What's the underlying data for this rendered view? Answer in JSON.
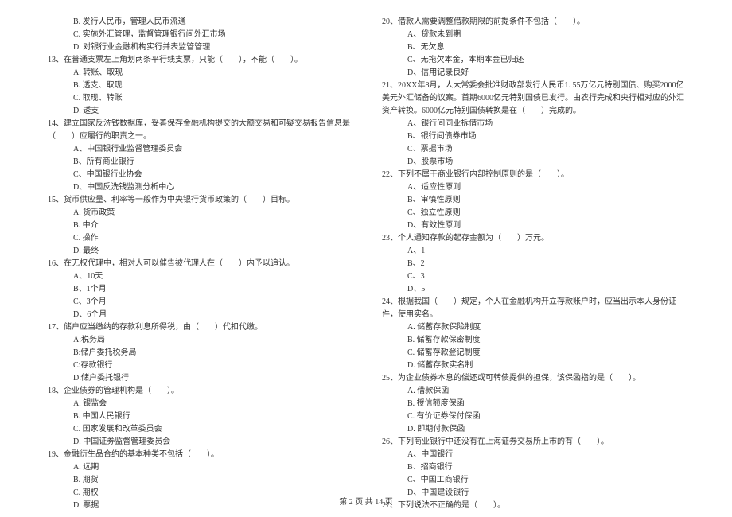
{
  "col_left": {
    "q12_opts": {
      "B": "B. 发行人民币，管理人民币流通",
      "C": "C. 实施外汇管理，监督管理银行间外汇市场",
      "D": "D. 对银行业金融机构实行并表监管管理"
    },
    "q13": {
      "stem": "13、在普通支票左上角划两条平行线支票，只能（　　），不能（　　）。",
      "A": "A. 转账、取现",
      "B": "B. 透支、取现",
      "C": "C. 取现、转账",
      "D": "D. 透支"
    },
    "q14": {
      "stem": "14、建立国家反洗钱数据库，妥善保存金融机构提交的大额交易和可疑交易报告信息是（　　）应履行的职责之一。",
      "A": "A、中国银行业监督管理委员会",
      "B": "B、所有商业银行",
      "C": "C、中国银行业协会",
      "D": "D、中国反洗钱监测分析中心"
    },
    "q15": {
      "stem": "15、货币供应量、利率等一般作为中央银行货币政策的（　　）目标。",
      "A": "A. 货币政策",
      "B": "B. 中介",
      "C": "C. 操作",
      "D": "D. 最终"
    },
    "q16": {
      "stem": "16、在无权代理中，相对人可以催告被代理人在（　　）内予以追认。",
      "A": "A、10天",
      "B": "B、1个月",
      "C": "C、3个月",
      "D": "D、6个月"
    },
    "q17": {
      "stem": "17、储户应当缴纳的存款利息所得税，由（　　）代扣代缴。",
      "A": "A:税务局",
      "B": "B:储户委托税务局",
      "C": "C:存款银行",
      "D": "D:储户委托银行"
    },
    "q18": {
      "stem": "18、企业债券的管理机构是（　　）。",
      "A": "A. 银监会",
      "B": "B. 中国人民银行",
      "C": "C. 国家发展和改革委员会",
      "D": "D. 中国证券监督管理委员会"
    },
    "q19": {
      "stem": "19、金融衍生品合约的基本种类不包括（　　）。",
      "A": "A. 远期",
      "B": "B. 期货",
      "C": "C. 期权",
      "D": "D. 票据"
    }
  },
  "col_right": {
    "q20": {
      "stem": "20、借款人需要调整借款期限的前提条件不包括（　　）。",
      "A": "A、贷款未到期",
      "B": "B、无欠息",
      "C": "C、无拖欠本金，本期本金已归还",
      "D": "D、信用记录良好"
    },
    "q21": {
      "stem": "21、20XX年8月，人大常委会批准财政部发行人民币1. 55万亿元特别国债、购买2000亿美元外汇储备的议案。首期6000亿元特别国债已发行。由农行完成和央行相对应的外汇资产转换。6000亿元特别国债转换是在（　　）完成的。",
      "A": "A、银行间同业拆借市场",
      "B": "B、银行间债券市场",
      "C": "C、票据市场",
      "D": "D、股票市场"
    },
    "q22": {
      "stem": "22、下列不属于商业银行内部控制原则的是（　　）。",
      "A": "A、适应性原则",
      "B": "B、审慎性原则",
      "C": "C、独立性原则",
      "D": "D、有效性原则"
    },
    "q23": {
      "stem": "23、个人通知存款的起存金额为（　　）万元。",
      "A": "A、1",
      "B": "B、2",
      "C": "C、3",
      "D": "D、5"
    },
    "q24": {
      "stem": "24、根据我国（　　）规定，个人在金融机构开立存款账户时，应当出示本人身份证件，使用实名。",
      "A": "A. 储蓄存款保险制度",
      "B": "B. 储蓄存款保密制度",
      "C": "C. 储蓄存款登记制度",
      "D": "D. 储蓄存款实名制"
    },
    "q25": {
      "stem": "25、为企业债券本息的偿还或可转债提供的担保，该保函指的是（　　）。",
      "A": "A. 借款保函",
      "B": "B. 授信额度保函",
      "C": "C. 有价证券保付保函",
      "D": "D. 即期付款保函"
    },
    "q26": {
      "stem": "26、下列商业银行中还没有在上海证券交易所上市的有（　　）。",
      "A": "A、中国银行",
      "B": "B、招商银行",
      "C": "C、中国工商银行",
      "D": "D、中国建设银行"
    },
    "q27": {
      "stem": "27、下列说法不正确的是（　　）。"
    }
  },
  "footer": "第 2 页 共 14 页"
}
